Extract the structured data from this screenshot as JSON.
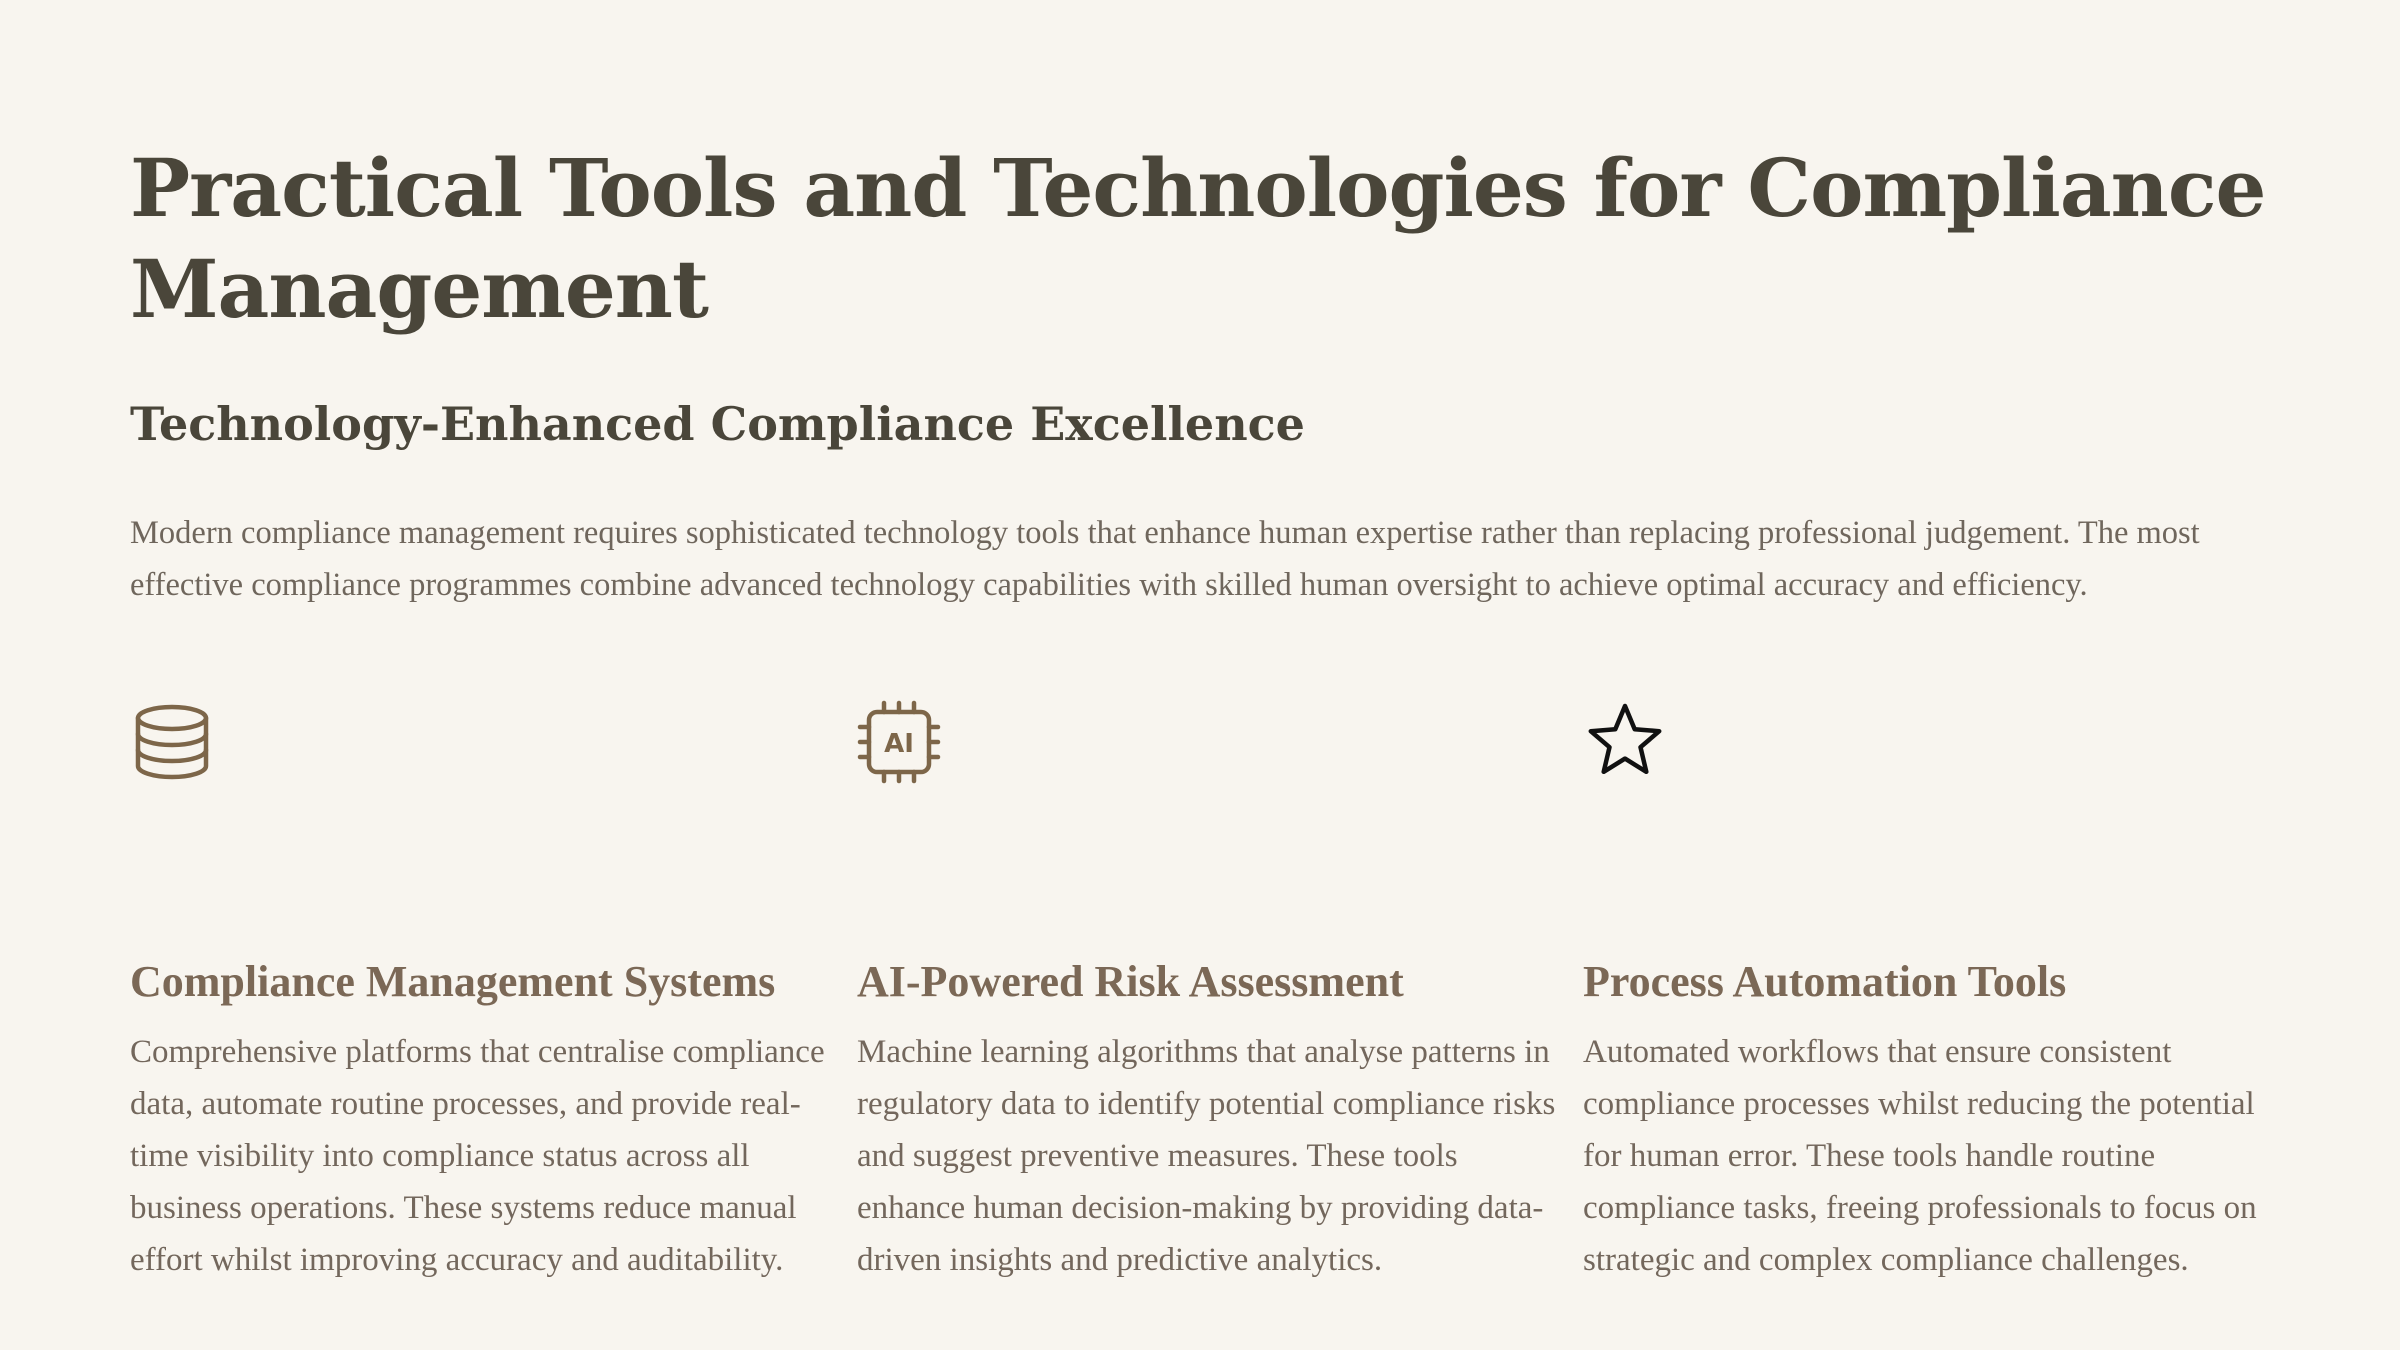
{
  "slide": {
    "title": "Practical Tools and Technologies for Compliance Management",
    "subtitle": "Technology-Enhanced Compliance Excellence",
    "intro": "Modern compliance management requires sophisticated technology tools that enhance human expertise rather than replacing professional judgement. The most effective compliance programmes combine advanced technology capabilities with skilled human oversight to achieve optimal accuracy and efficiency."
  },
  "features": [
    {
      "icon": "database-icon",
      "title": "Compliance Management Systems",
      "text": "Comprehensive platforms that centralise compliance data, automate routine processes, and provide real-time visibility into compliance status across all business operations. These systems reduce manual effort whilst improving accuracy and auditability."
    },
    {
      "icon": "ai-chip-icon",
      "icon_label": "AI",
      "title": "AI-Powered Risk Assessment",
      "text": "Machine learning algorithms that analyse patterns in regulatory data to identify potential compliance risks and suggest preventive measures. These tools enhance human decision-making by providing data-driven insights and predictive analytics."
    },
    {
      "icon": "star-icon",
      "title": "Process Automation Tools",
      "text": "Automated workflows that ensure consistent compliance processes whilst reducing the potential for human error. These tools handle routine compliance tasks, freeing professionals to focus on strategic and complex compliance challenges."
    }
  ],
  "colors": {
    "background": "#f8f5ef",
    "heading": "#4a463a",
    "accent": "#7b6856",
    "icon": "#7d6649",
    "body_text": "#6f665c"
  }
}
